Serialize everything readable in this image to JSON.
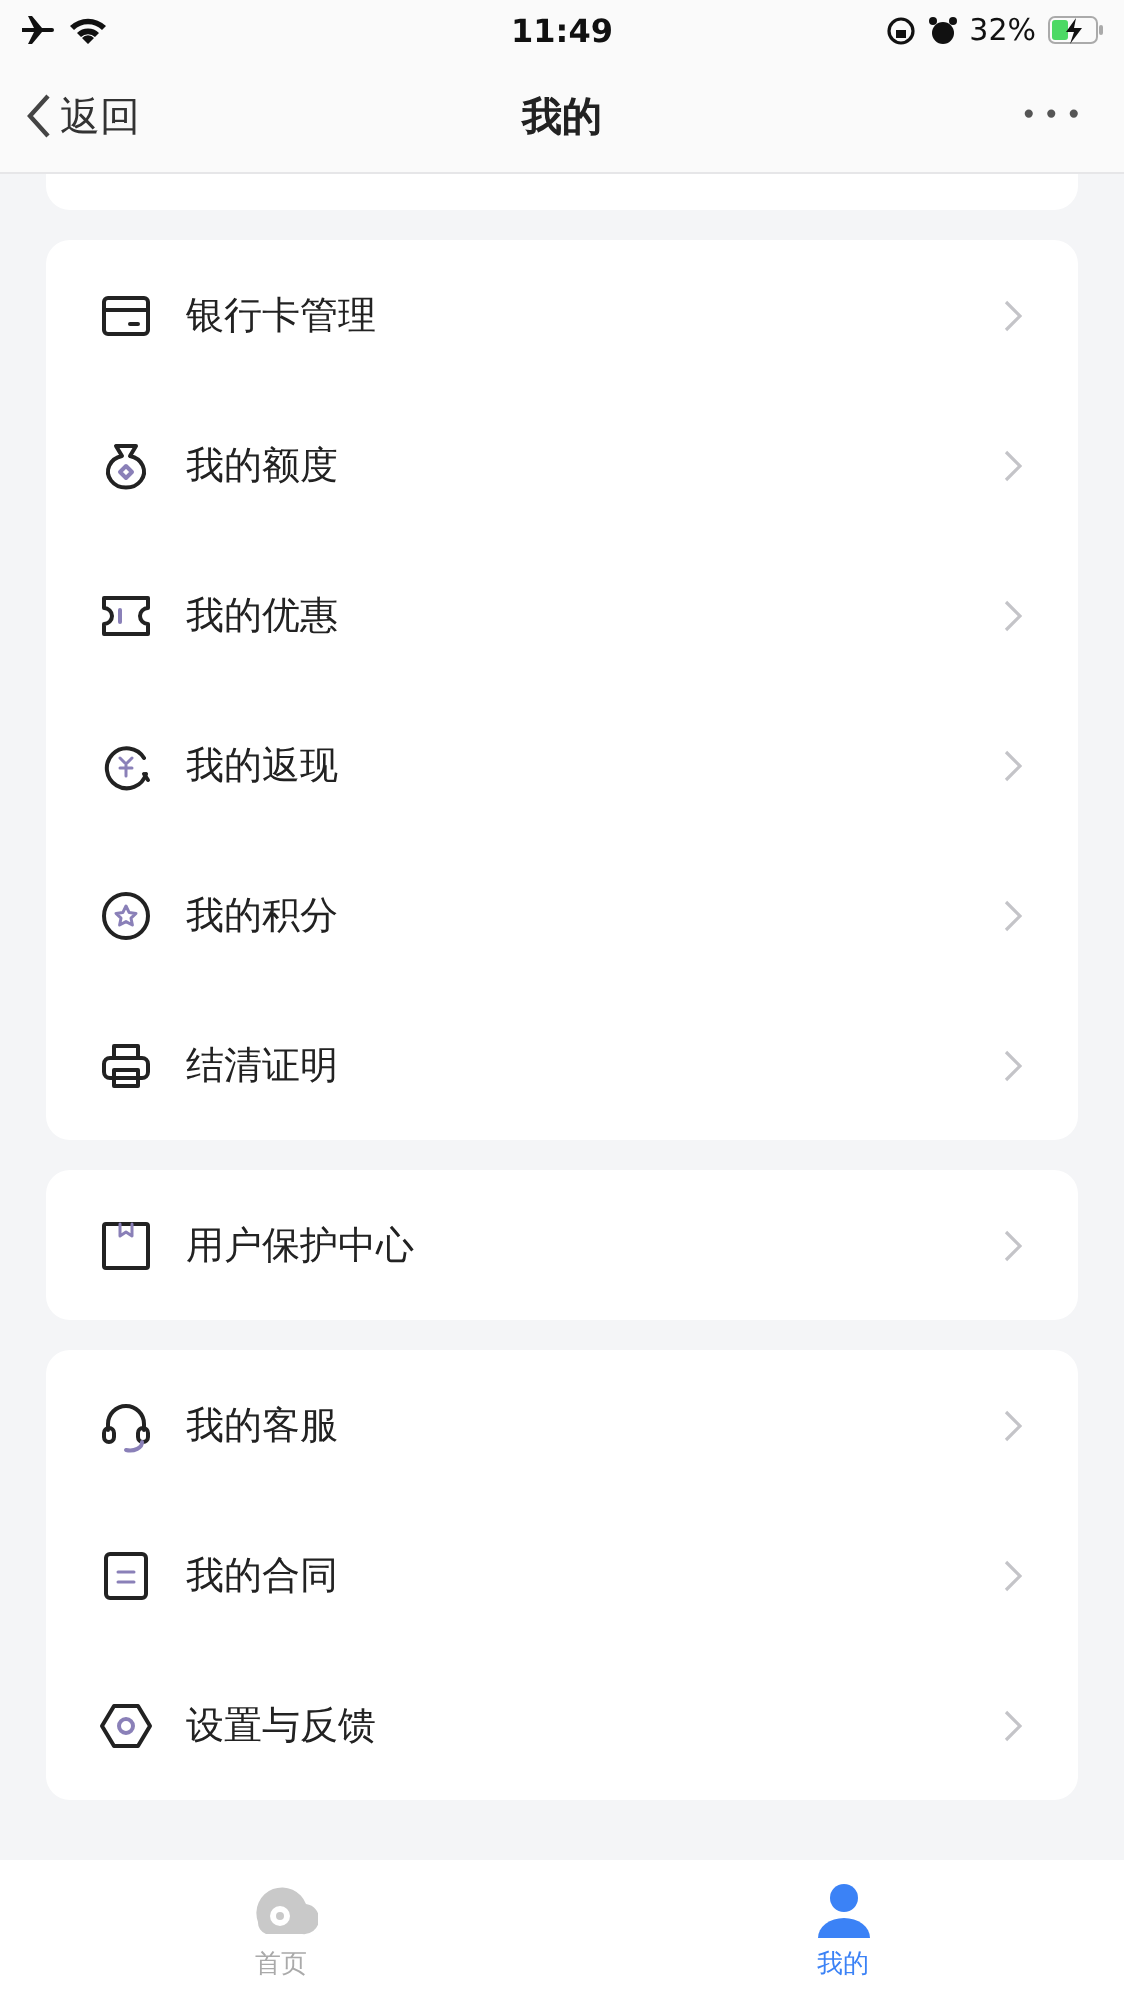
{
  "status_bar": {
    "time": "11:49",
    "battery": "32%"
  },
  "nav": {
    "back": "返回",
    "title": "我的",
    "more": "•••"
  },
  "groups": [
    {
      "items": [
        {
          "label": "银行卡管理",
          "kind": "card"
        },
        {
          "label": "我的额度",
          "kind": "bag"
        },
        {
          "label": "我的优惠",
          "kind": "ticket"
        },
        {
          "label": "我的返现",
          "kind": "cashback"
        },
        {
          "label": "我的积分",
          "kind": "star"
        },
        {
          "label": "结清证明",
          "kind": "printer"
        }
      ]
    },
    {
      "items": [
        {
          "label": "用户保护中心",
          "kind": "shield"
        }
      ]
    },
    {
      "items": [
        {
          "label": "我的客服",
          "kind": "headset"
        },
        {
          "label": "我的合同",
          "kind": "doc"
        },
        {
          "label": "设置与反馈",
          "kind": "settings"
        }
      ]
    }
  ],
  "tabs": [
    {
      "label": "首页",
      "kind": "home",
      "selected": false
    },
    {
      "label": "我的",
      "kind": "person",
      "selected": true
    }
  ]
}
